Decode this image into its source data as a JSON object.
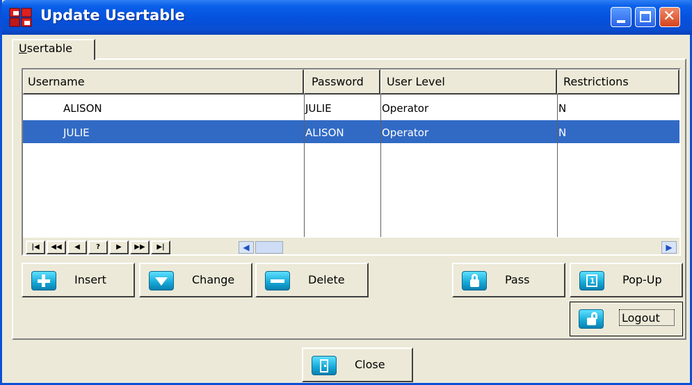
{
  "window": {
    "title": "Update Usertable",
    "controls": [
      "minimize-icon",
      "maximize-icon",
      "close-icon"
    ]
  },
  "tabs": [
    {
      "label": "Usertable",
      "accel": "U"
    }
  ],
  "grid": {
    "columns": [
      "Username",
      "Password",
      "User Level",
      "Restrictions"
    ],
    "rows": [
      {
        "username": "ALISON",
        "password": "JULIE",
        "level": "Operator",
        "restrictions": "N",
        "selected": false
      },
      {
        "username": "JULIE",
        "password": "ALISON",
        "level": "Operator",
        "restrictions": "N",
        "selected": true
      }
    ],
    "navigator": [
      "first-icon",
      "prior-page-icon",
      "prior-icon",
      "?",
      "next-icon",
      "next-page-icon",
      "last-icon"
    ]
  },
  "buttons": {
    "insert": "Insert",
    "change": "Change",
    "delete": "Delete",
    "pass": "Pass",
    "popup": "Pop-Up",
    "logout": "Logout",
    "close": "Close"
  },
  "colors": {
    "titlebar": "#0550dc",
    "selection": "#316ac5",
    "face": "#ece9d8"
  }
}
